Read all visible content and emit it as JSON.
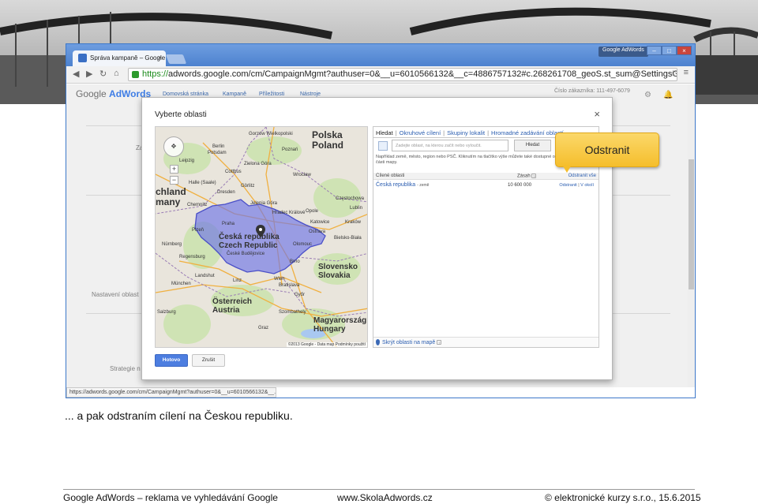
{
  "browser": {
    "tab_title": "Správa kampaně – Google A",
    "tab_close": "×",
    "brand_badge": "Google AdWords",
    "url_scheme": "https://",
    "url_rest": "adwords.google.com/cm/CampaignMgmt?authuser=0&__u=6010566132&__c=4886757132#c.268261708_geoS.st_sum@SettingsGeoV2Cell",
    "status_url": "https://adwords.google.com/cm/CampaignMgmt?authuser=0&__u=6010566132&__...",
    "win_controls": [
      "–",
      "□",
      "×"
    ]
  },
  "page": {
    "logo_google": "Google",
    "logo_adwords": "AdWords",
    "nav": [
      "Domovská stránka",
      "Kampaně",
      "Příležitosti",
      "Nástroje"
    ],
    "customer_id": "Číslo zákazníka: 111-497-6079",
    "partial_labels": [
      "Za",
      "Nastavení oblast",
      "Strategie n"
    ]
  },
  "dialog": {
    "title": "Vyberte oblasti",
    "close": "×",
    "tabs": [
      "Hledat",
      "Okruhové cílení",
      "Skupiny lokalit",
      "Hromadné zadávání oblastí"
    ],
    "search_placeholder": "Zadejte oblast, na kterou začít nebo vyloučit.",
    "search_button": "Hledat",
    "hint": "Například země, město, region nebo PSČ. Kliknutím na tlačítko výše můžete také dostupné oblasti ve viditelné části mapy.",
    "table_headers": {
      "name": "Cílené oblasti",
      "reach": "Zásah",
      "remove_all": "Odstranit vše"
    },
    "rows": [
      {
        "name": "Česká republika",
        "type": "- země",
        "reach": "10 600 000",
        "remove": "Odstranit",
        "sep": "|",
        "nearby": "V okolí"
      }
    ],
    "hide_map": "Skrýt oblasti na mapě",
    "done": "Hotovo",
    "cancel": "Zrušit"
  },
  "map": {
    "countries": [
      {
        "label": "Polska",
        "label2": "Poland"
      },
      {
        "label": "Česká republika",
        "label2": "Czech Republic"
      },
      {
        "label": "Slovensko",
        "label2": "Slovakia"
      },
      {
        "label": "Österreich",
        "label2": "Austria"
      },
      {
        "label": "Magyarország",
        "label2": "Hungary"
      },
      {
        "label": "chland",
        "label2": "many"
      }
    ],
    "cities": [
      "Gorzów Wielkopolski",
      "Berlin",
      "Poznań",
      "Zielona Góra",
      "Wrocław",
      "Dresden",
      "Halle (Saale)",
      "Chemnitz",
      "Görlitz",
      "Hradec Králové",
      "Opole",
      "Częstochowa",
      "Katowice",
      "Kraków",
      "Praha",
      "Olomouc",
      "Ostrava",
      "Brno",
      "Plzeň",
      "České Budějovice",
      "Regensburg",
      "Nürnberg",
      "Landshut",
      "München",
      "Linz",
      "Wien",
      "Bratislava",
      "Győr",
      "Graz",
      "Szombathely",
      "Salzburg",
      "Bielsko-Biała",
      "Jelenia Góra",
      "Cottbus",
      "Lublin",
      "Potsdam",
      "Leipzig"
    ],
    "footer": "©2013 Google - Data map  Podmínky použití",
    "highlight_color": "#6f74e6"
  },
  "callout": {
    "text": "Odstranit",
    "color": "#f5be2c"
  },
  "caption": "... a pak odstraním cílení na Českou republiku.",
  "footer": {
    "left": "Google AdWords – reklama ve vyhledávání Google",
    "center": "www.SkolaAdwords.cz",
    "right": "© elektronické kurzy s.r.o., 15.6.2015"
  }
}
